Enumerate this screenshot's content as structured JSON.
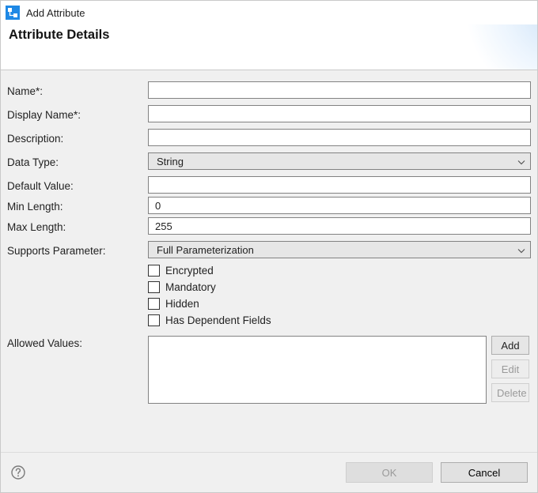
{
  "window": {
    "title": "Add Attribute",
    "heading": "Attribute Details"
  },
  "fields": {
    "name_label": "Name*:",
    "name_value": "",
    "display_name_label": "Display Name*:",
    "display_name_value": "",
    "description_label": "Description:",
    "description_value": "",
    "data_type_label": "Data Type:",
    "data_type_value": "String",
    "default_value_label": "Default Value:",
    "default_value_value": "",
    "min_length_label": "Min Length:",
    "min_length_value": "0",
    "max_length_label": "Max Length:",
    "max_length_value": "255",
    "supports_param_label": "Supports Parameter:",
    "supports_param_value": "Full Parameterization",
    "allowed_values_label": "Allowed Values:"
  },
  "checks": {
    "encrypted": "Encrypted",
    "mandatory": "Mandatory",
    "hidden": "Hidden",
    "has_dependent": "Has Dependent Fields"
  },
  "buttons": {
    "add": "Add",
    "edit": "Edit",
    "delete": "Delete",
    "ok": "OK",
    "cancel": "Cancel"
  }
}
